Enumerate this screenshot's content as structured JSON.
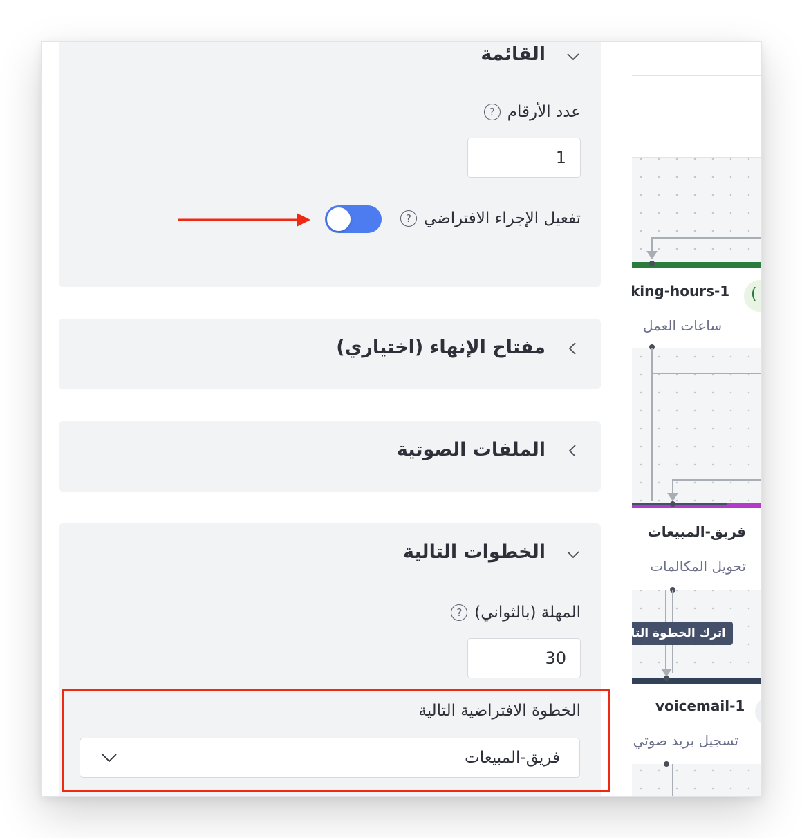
{
  "list_section": {
    "title": "القائمة",
    "digits_label": "عدد الأرقام",
    "digits_value": "1",
    "default_action_label": "تفعيل الإجراء الافتراضي",
    "default_action_enabled": true
  },
  "termination_section": {
    "title": "مفتاح الإنهاء (اختياري)"
  },
  "audio_section": {
    "title": "الملفات الصوتية"
  },
  "next_steps_section": {
    "title": "الخطوات التالية",
    "timeout_label": "المهلة (بالثواني)",
    "timeout_value": "30",
    "default_next_step_label": "الخطوة الافتراضية التالية",
    "default_next_step_value": "فريق-المبيعات"
  },
  "help_glyph": "?",
  "flow": {
    "node_working_hours": {
      "title": "king-hours-1",
      "subtitle": "ساعات العمل",
      "badge": "("
    },
    "node_sales_team": {
      "title": "فريق-المبيعات",
      "subtitle": "تحويل المكالمات"
    },
    "skip_label": "اترك الخطوة التالية",
    "node_voicemail": {
      "title": "voicemail-1",
      "subtitle": "تسجيل بريد صوتي"
    }
  },
  "colors": {
    "accent_blue": "#4d7cf1",
    "annotation_red": "#ee2a12",
    "working_hours_bar": "#2b7a3e",
    "sales_bar": "#b23bc8",
    "voicemail_bar": "#334158"
  }
}
